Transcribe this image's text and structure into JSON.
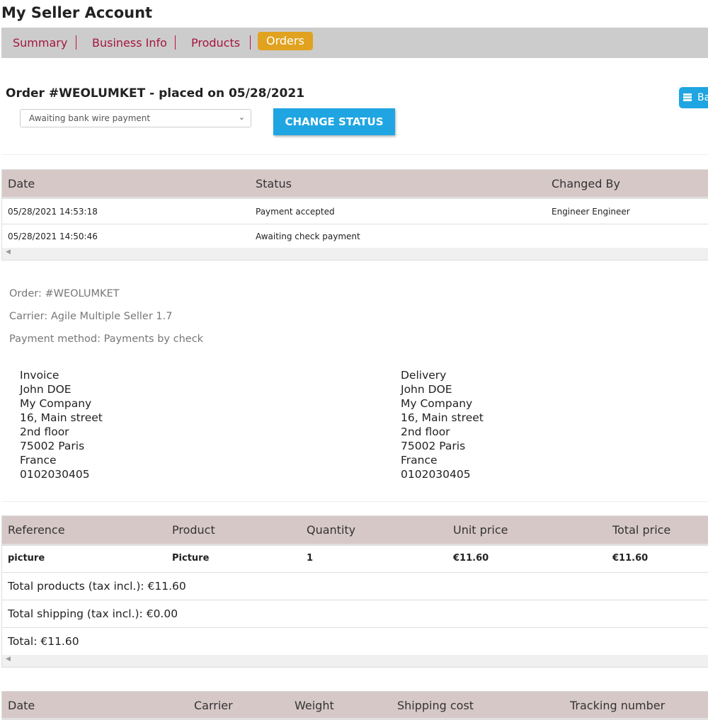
{
  "page_title": "My Seller Account",
  "nav": [
    {
      "label": "Summary"
    },
    {
      "label": "Business Info"
    },
    {
      "label": "Products"
    },
    {
      "label": "Orders",
      "active": true
    }
  ],
  "order": {
    "heading": "Order #WEOLUMKET - placed on 05/28/2021",
    "status_select": "Awaiting bank wire payment",
    "change_status_label": "CHANGE STATUS",
    "back_label": "Ba"
  },
  "history": {
    "headers": [
      "Date",
      "Status",
      "Changed By"
    ],
    "rows": [
      [
        "05/28/2021 14:53:18",
        "Payment accepted",
        "Engineer Engineer"
      ],
      [
        "05/28/2021 14:50:46",
        "Awaiting check payment",
        ""
      ]
    ]
  },
  "info": {
    "order": "Order: #WEOLUMKET",
    "carrier": "Carrier: Agile Multiple Seller 1.7",
    "payment": "Payment method: Payments by check"
  },
  "invoice": [
    "Invoice",
    "John DOE",
    "My Company",
    "16, Main street",
    "2nd floor",
    "75002 Paris",
    "France",
    "0102030405"
  ],
  "delivery": [
    "Delivery",
    "John DOE",
    "My Company",
    "16, Main street",
    "2nd floor",
    "75002 Paris",
    "France",
    "0102030405"
  ],
  "products": {
    "headers": [
      "Reference",
      "Product",
      "Quantity",
      "Unit price",
      "Total price"
    ],
    "rows": [
      [
        "picture",
        "Picture",
        "1",
        "€11.60",
        "€11.60"
      ]
    ],
    "totals": [
      "Total products (tax incl.): €11.60",
      "Total shipping (tax incl.): €0.00",
      "Total: €11.60"
    ]
  },
  "shipping": {
    "headers": [
      "Date",
      "Carrier",
      "Weight",
      "Shipping cost",
      "Tracking number"
    ]
  },
  "colors": {
    "accent": "#1fa5e1",
    "active_tab": "#e1a21f",
    "nav_link": "#a4163e",
    "table_header": "#d7c8c8"
  }
}
